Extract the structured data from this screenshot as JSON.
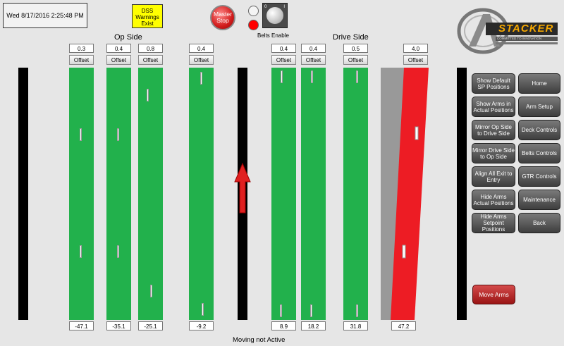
{
  "header": {
    "datetime": "Wed 8/17/2016 2:25:48 PM",
    "dss_warning": "DSS Warnings Exist",
    "master_stop": "Master Stop",
    "belts_enable": "Belts Enable",
    "selector_left": "0",
    "selector_right": "I"
  },
  "logo": {
    "brand": "STACKER",
    "tagline": "COMMITTED TO INNOVATION"
  },
  "sections": {
    "op_side": "Op Side",
    "drive_side": "Drive Side"
  },
  "offset_label": "Offset",
  "lanes": [
    {
      "top": "0.3",
      "bottom": "-47.1"
    },
    {
      "top": "0.4",
      "bottom": "-35.1"
    },
    {
      "top": "0.8",
      "bottom": "-25.1"
    },
    {
      "top": "0.4",
      "bottom": "-9.2"
    },
    {
      "top": "0.4",
      "bottom": "8.9"
    },
    {
      "top": "0.4",
      "bottom": "18.2"
    },
    {
      "top": "0.5",
      "bottom": "31.8"
    },
    {
      "top": "4.0",
      "bottom": "47.2"
    }
  ],
  "buttons_left": [
    "Show Default SP Positions",
    "Show Arms in Actual Positions",
    "Mirror Op Side to Drive Side",
    "Mirror Drive Side to Op Side",
    "Align All Exit to Entry",
    "Hide Arms Actual Positions",
    "Hide Arms Setpoint Positions"
  ],
  "buttons_right": [
    "Home",
    "Arm Setup",
    "Deck Controls",
    "Belts Controls",
    "GTR Controls",
    "Maintenance",
    "Back"
  ],
  "move_arms": "Move Arms",
  "status": "Moving not Active",
  "colors": {
    "lane_green": "#22b14c",
    "arm_red": "#ed1c24",
    "arm_gray": "#999999",
    "warning_yellow": "#ffff00",
    "move_button": "#b22222"
  }
}
